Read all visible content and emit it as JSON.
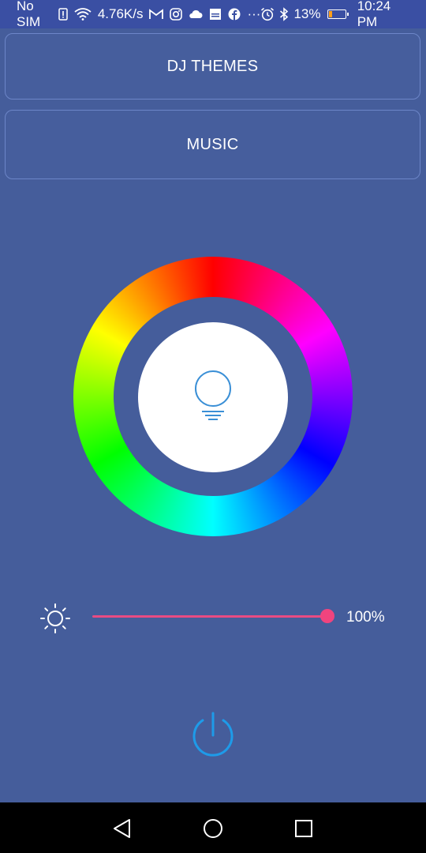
{
  "status_bar": {
    "carrier": "No SIM",
    "speed": "4.76K/s",
    "ellipsis": "···",
    "battery_pct": "13%",
    "battery_level": 0.13,
    "time": "10:24 PM"
  },
  "buttons": {
    "dj_themes": "DJ THEMES",
    "music": "MUSIC"
  },
  "brightness": {
    "value": 1.0,
    "label": "100%"
  },
  "colors": {
    "background": "#455d9b",
    "status_bar": "#3a4fa3",
    "slider_accent": "#f0447e",
    "power_icon": "#1e9be9",
    "bulb_icon": "#3a8fd6"
  },
  "icons": {
    "bulb": "lightbulb-icon",
    "sun": "sun-icon",
    "power": "power-icon",
    "back": "back-triangle-icon",
    "home": "home-circle-icon",
    "recent": "recent-square-icon"
  }
}
